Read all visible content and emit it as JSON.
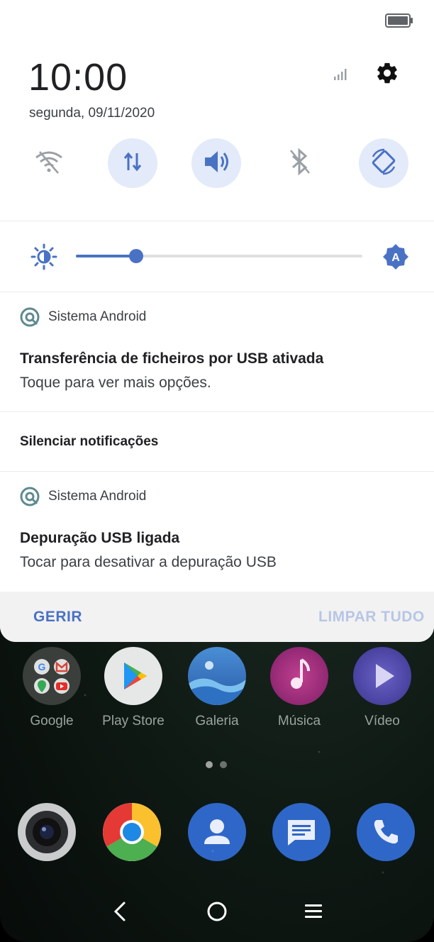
{
  "status": {
    "time": "10:00",
    "date": "segunda, 09/11/2020",
    "accent_color": "#4a72c4"
  },
  "quick_settings": [
    {
      "name": "wifi-icon",
      "active": false
    },
    {
      "name": "mobile-data-icon",
      "active": true
    },
    {
      "name": "sound-icon",
      "active": true
    },
    {
      "name": "bluetooth-icon",
      "active": false
    },
    {
      "name": "auto-rotate-icon",
      "active": true
    }
  ],
  "brightness": {
    "level": 0.21,
    "auto_icon_letter": "A"
  },
  "notifications": [
    {
      "app": "Sistema Android",
      "title": "Transferência de ficheiros por USB ativada",
      "text": "Toque para ver mais opções."
    },
    {
      "app": "Sistema Android",
      "title": "Depuração USB ligada",
      "text": "Tocar para desativar a depuração USB"
    }
  ],
  "silence_header": "Silenciar notificações",
  "footer": {
    "manage_label": "GERIR",
    "clear_label": "LIMPAR TUDO"
  },
  "home": {
    "apps": [
      {
        "label": "Google",
        "icon": "google-folder-icon"
      },
      {
        "label": "Play Store",
        "icon": "play-store-icon"
      },
      {
        "label": "Galeria",
        "icon": "gallery-icon"
      },
      {
        "label": "Música",
        "icon": "music-icon"
      },
      {
        "label": "Vídeo",
        "icon": "video-icon"
      }
    ],
    "dock": [
      "camera-icon",
      "chrome-icon",
      "contacts-icon",
      "messages-icon",
      "phone-icon"
    ],
    "page_count": 2,
    "current_page": 1
  }
}
